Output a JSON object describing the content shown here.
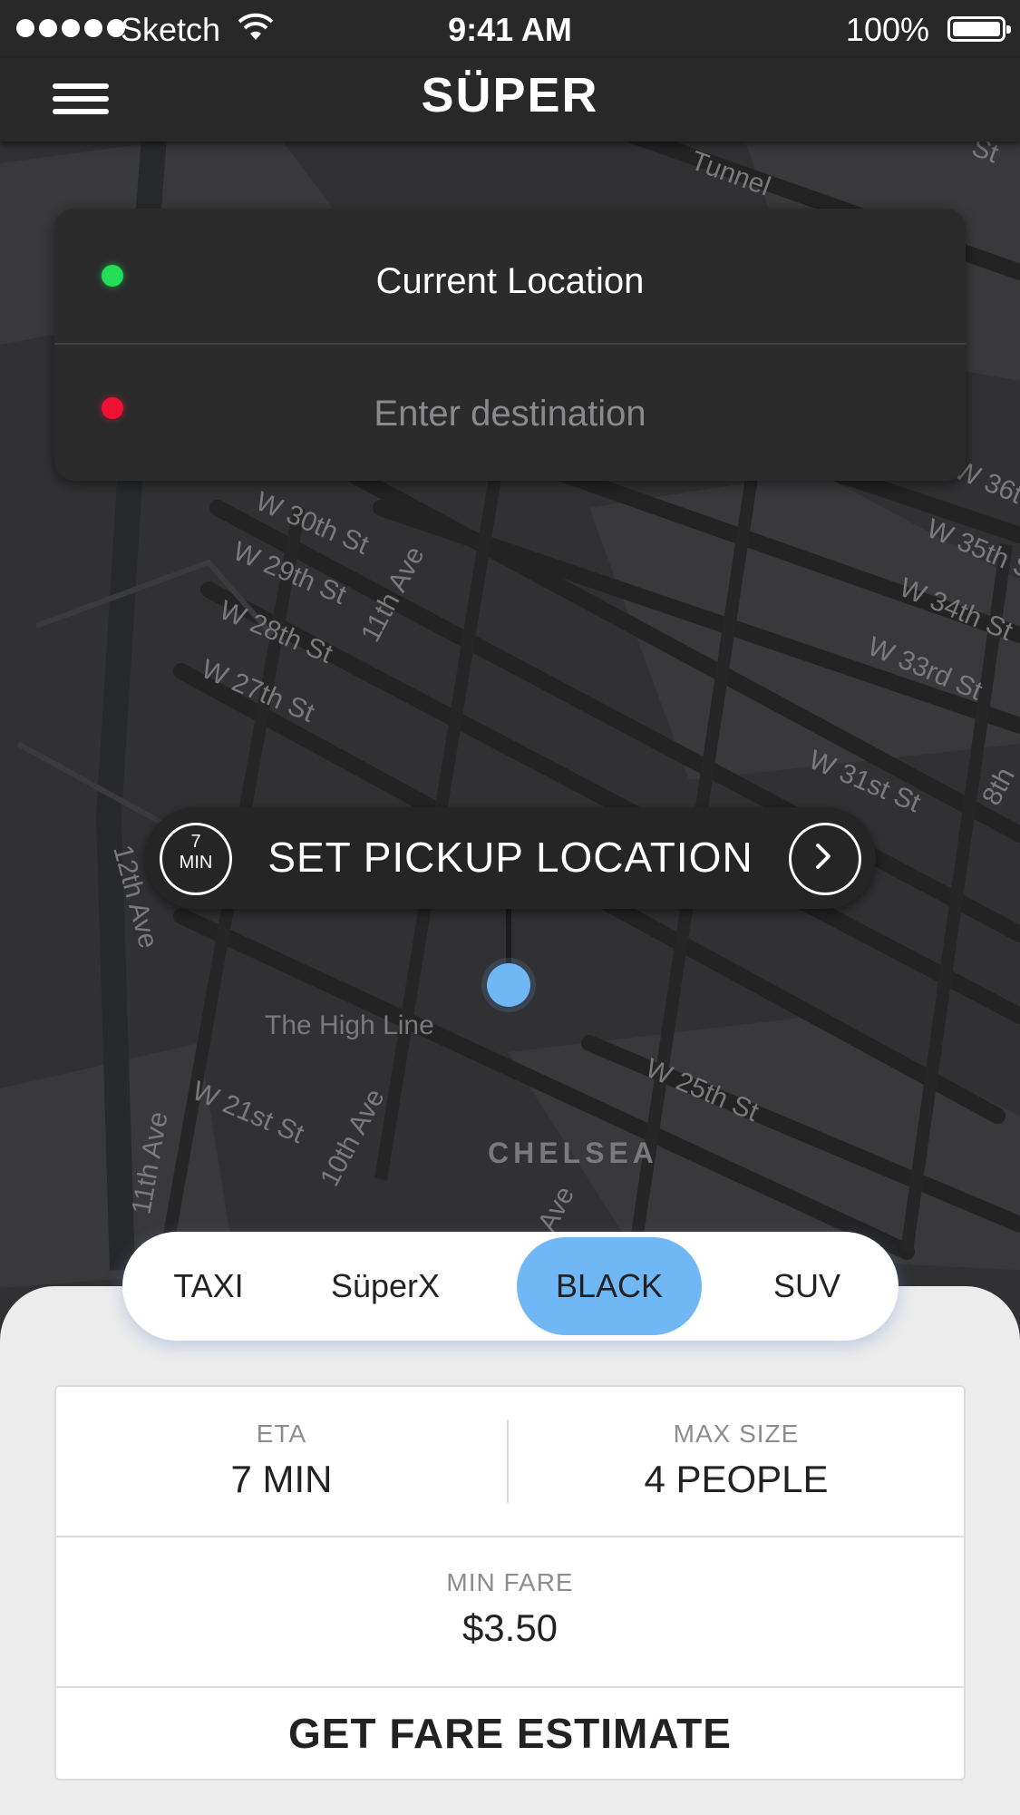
{
  "status_bar": {
    "carrier": "Sketch",
    "time": "9:41 AM",
    "battery": "100%"
  },
  "navbar": {
    "title": "SÜPER"
  },
  "location": {
    "current": "Current Location",
    "destination_placeholder": "Enter destination"
  },
  "map": {
    "labels": [
      "Tunnel",
      "St",
      "W 30th St",
      "W 29th St",
      "W 28th St",
      "W 27th St",
      "11th Ave",
      "W 36t",
      "W 35th St",
      "W 34th St",
      "W 33rd St",
      "W 31st St",
      "8th",
      "12th Ave",
      "The High Line",
      "W 25th St",
      "W 21st St",
      "10th Ave",
      "11th Ave",
      "CHELSEA",
      "Ave"
    ]
  },
  "pickup": {
    "eta_value": "7",
    "eta_unit": "MIN",
    "label": "SET PICKUP LOCATION"
  },
  "ride_types": [
    "TAXI",
    "SüperX",
    "BLACK",
    "SUV"
  ],
  "selected_ride": "BLACK",
  "details": {
    "eta_label": "ETA",
    "eta_value": "7 MIN",
    "max_size_label": "MAX SIZE",
    "max_size_value": "4 PEOPLE",
    "min_fare_label": "MIN FARE",
    "min_fare_value": "$3.50",
    "estimate_button": "GET FARE ESTIMATE"
  },
  "colors": {
    "accent": "#6fb7f5",
    "pickup_dot": "#22dd55",
    "destination_dot": "#ee1133",
    "bar": "#282828",
    "map": "#2f2f30"
  }
}
